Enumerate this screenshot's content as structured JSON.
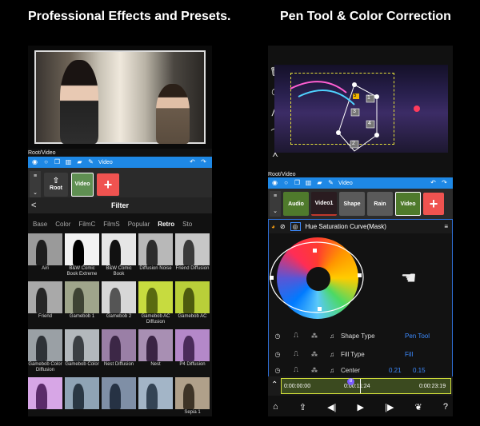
{
  "headlines": {
    "left": "Professional Effects and Presets.",
    "right": "Pen Tool & Color Correction"
  },
  "left_panel": {
    "path_label": "Root/Video",
    "toolbar_label": "Video",
    "tracks": [
      {
        "label": "Root",
        "color": "#3a3a3a"
      },
      {
        "label": "Video",
        "color": "#5f8f52"
      }
    ],
    "add_label": "+",
    "filter_title": "Filter",
    "back_label": "<",
    "categories": [
      {
        "label": "Base",
        "active": false
      },
      {
        "label": "Color",
        "active": false
      },
      {
        "label": "FilmC",
        "active": false
      },
      {
        "label": "FilmS",
        "active": false
      },
      {
        "label": "Popular",
        "active": false
      },
      {
        "label": "Retro",
        "active": true
      },
      {
        "label": "Sto",
        "active": false
      }
    ],
    "filters": [
      {
        "name": "Airi",
        "bg": "#9a9a9a",
        "fig": "#1e1e1e"
      },
      {
        "name": "B&W Comic Book Extreme",
        "bg": "#f2f2f2",
        "fig": "#000000"
      },
      {
        "name": "B&W Comic Book",
        "bg": "#e6e6e6",
        "fig": "#111111"
      },
      {
        "name": "Diffusion Noise",
        "bg": "#b8b8b8",
        "fig": "#2c2c2c"
      },
      {
        "name": "Friend Diffusion",
        "bg": "#c7c7c7",
        "fig": "#3a3a3a"
      },
      {
        "name": "Friend",
        "bg": "#a9a9a9",
        "fig": "#262626"
      },
      {
        "name": "Gamebob 1",
        "bg": "#9fa58b",
        "fig": "#3e4334"
      },
      {
        "name": "Gamebob 2",
        "bg": "#d7d7d7",
        "fig": "#555555"
      },
      {
        "name": "Gamebob AC Diffusion",
        "bg": "#c7db3f",
        "fig": "#5a6a10"
      },
      {
        "name": "Gamebob AC",
        "bg": "#b9cf39",
        "fig": "#4d5a0e"
      },
      {
        "name": "Gamebob Color Diffusion",
        "bg": "#9aa0a5",
        "fig": "#2e3237"
      },
      {
        "name": "Gamebob Color",
        "bg": "#b3b8bc",
        "fig": "#3b3f43"
      },
      {
        "name": "Nest Diffusion",
        "bg": "#9a7fa6",
        "fig": "#3c2746"
      },
      {
        "name": "Nest",
        "bg": "#a88fb3",
        "fig": "#3a2444"
      },
      {
        "name": "P4 Diffusion",
        "bg": "#b488c9",
        "fig": "#4a2b5a"
      },
      {
        "name": "",
        "bg": "#d7a6e6",
        "fig": "#5b2b6a"
      },
      {
        "name": "",
        "bg": "#8fa3b5",
        "fig": "#2a3744"
      },
      {
        "name": "",
        "bg": "#7f8fa6",
        "fig": "#263244"
      },
      {
        "name": "",
        "bg": "#a3b5c7",
        "fig": "#344455"
      },
      {
        "name": "Sepia 1",
        "bg": "#b0a08a",
        "fig": "#3e3427"
      }
    ]
  },
  "right_panel": {
    "path_label": "Root/Video",
    "toolbar_label": "Video",
    "tracks": [
      {
        "label": "Audio",
        "color": "#4f7a2c"
      },
      {
        "label": "Video1",
        "color": "#2a1c20"
      },
      {
        "label": "Shape",
        "color": "#5a5a5a"
      },
      {
        "label": "Rain",
        "color": "#5a5a5a"
      },
      {
        "label": "Video",
        "color": "#4f7a2c"
      }
    ],
    "add_label": "+",
    "effect_title": "Hue Saturation Curve(Mask)",
    "points": [
      "1",
      "2",
      "3",
      "4",
      "5"
    ],
    "properties": [
      {
        "name": "Shape Type",
        "value": "Pen Tool",
        "value_color": "#3d8bff"
      },
      {
        "name": "Fill Type",
        "value": "Fill",
        "value_color": "#3d8bff"
      },
      {
        "name": "Center",
        "value": "0.21",
        "value2": "0.15",
        "value_color": "#3d8bff"
      }
    ],
    "timeline": {
      "start": "0:00:00:00",
      "current": "0:00:11:24",
      "end": "0:00:23:19",
      "marker": "8"
    }
  }
}
